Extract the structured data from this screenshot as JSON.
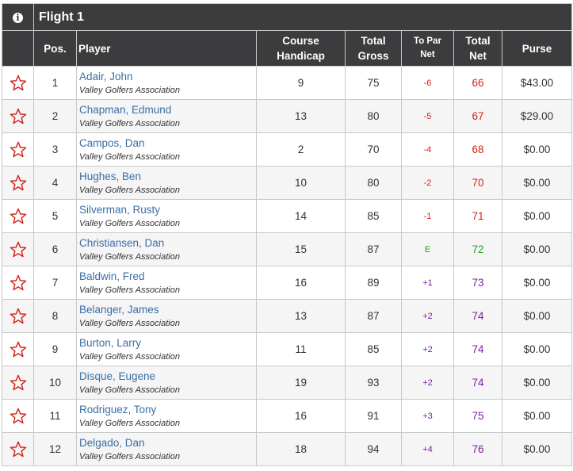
{
  "flight": {
    "title": "Flight 1"
  },
  "columns": {
    "pos": "Pos.",
    "player": "Player",
    "course_handicap_1": "Course",
    "course_handicap_2": "Handicap",
    "total_gross_1": "Total",
    "total_gross_2": "Gross",
    "to_par_1": "To Par",
    "to_par_2": "Net",
    "total_net_1": "Total",
    "total_net_2": "Net",
    "purse": "Purse"
  },
  "colors": {
    "header_bg": "#3c3c3e",
    "player_link": "#3a6ea5",
    "under_par": "#d0261e",
    "even_par": "#2e9a2e",
    "over_par": "#7a1fa2",
    "star": "#d0261e"
  },
  "rows": [
    {
      "pos": "1",
      "name": "Adair, John",
      "org": "Valley Golfers Association",
      "handicap": "9",
      "gross": "75",
      "to_par": "-6",
      "net": "66",
      "purse": "$43.00",
      "status": "under"
    },
    {
      "pos": "2",
      "name": "Chapman, Edmund",
      "org": "Valley Golfers Association",
      "handicap": "13",
      "gross": "80",
      "to_par": "-5",
      "net": "67",
      "purse": "$29.00",
      "status": "under"
    },
    {
      "pos": "3",
      "name": "Campos, Dan",
      "org": "Valley Golfers Association",
      "handicap": "2",
      "gross": "70",
      "to_par": "-4",
      "net": "68",
      "purse": "$0.00",
      "status": "under"
    },
    {
      "pos": "4",
      "name": "Hughes, Ben",
      "org": "Valley Golfers Association",
      "handicap": "10",
      "gross": "80",
      "to_par": "-2",
      "net": "70",
      "purse": "$0.00",
      "status": "under"
    },
    {
      "pos": "5",
      "name": "Silverman, Rusty",
      "org": "Valley Golfers Association",
      "handicap": "14",
      "gross": "85",
      "to_par": "-1",
      "net": "71",
      "purse": "$0.00",
      "status": "under"
    },
    {
      "pos": "6",
      "name": "Christiansen, Dan",
      "org": "Valley Golfers Association",
      "handicap": "15",
      "gross": "87",
      "to_par": "E",
      "net": "72",
      "purse": "$0.00",
      "status": "even"
    },
    {
      "pos": "7",
      "name": "Baldwin, Fred",
      "org": "Valley Golfers Association",
      "handicap": "16",
      "gross": "89",
      "to_par": "+1",
      "net": "73",
      "purse": "$0.00",
      "status": "over"
    },
    {
      "pos": "8",
      "name": "Belanger, James",
      "org": "Valley Golfers Association",
      "handicap": "13",
      "gross": "87",
      "to_par": "+2",
      "net": "74",
      "purse": "$0.00",
      "status": "over"
    },
    {
      "pos": "9",
      "name": "Burton, Larry",
      "org": "Valley Golfers Association",
      "handicap": "11",
      "gross": "85",
      "to_par": "+2",
      "net": "74",
      "purse": "$0.00",
      "status": "over"
    },
    {
      "pos": "10",
      "name": "Disque, Eugene",
      "org": "Valley Golfers Association",
      "handicap": "19",
      "gross": "93",
      "to_par": "+2",
      "net": "74",
      "purse": "$0.00",
      "status": "over"
    },
    {
      "pos": "11",
      "name": "Rodriguez, Tony",
      "org": "Valley Golfers Association",
      "handicap": "16",
      "gross": "91",
      "to_par": "+3",
      "net": "75",
      "purse": "$0.00",
      "status": "over"
    },
    {
      "pos": "12",
      "name": "Delgado, Dan",
      "org": "Valley Golfers Association",
      "handicap": "18",
      "gross": "94",
      "to_par": "+4",
      "net": "76",
      "purse": "$0.00",
      "status": "over"
    }
  ]
}
